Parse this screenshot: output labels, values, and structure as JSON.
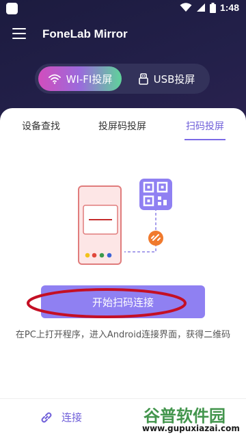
{
  "status_bar": {
    "time": "1:48"
  },
  "app_bar": {
    "title": "FoneLab Mirror",
    "menu_icon": "hamburger-icon"
  },
  "mode_switch": {
    "options": [
      {
        "label": "WI-FI投屏",
        "icon": "wifi-icon",
        "selected": true
      },
      {
        "label": "USB投屏",
        "icon": "usb-icon",
        "selected": false
      }
    ]
  },
  "tabs": [
    {
      "label": "设备查找",
      "active": false
    },
    {
      "label": "投屏码投屏",
      "active": false
    },
    {
      "label": "扫码投屏",
      "active": true
    }
  ],
  "main": {
    "start_button": "开始扫码连接",
    "hint": "在PC上打开程序，进入Android连接界面，获得二维码"
  },
  "bottom": {
    "connect_label": "连接",
    "connect_icon": "link-icon"
  },
  "watermark": {
    "text": "谷普软件园",
    "url": "www.gupuxiazai.com"
  },
  "colors": {
    "accent": "#7b6ae6",
    "button": "#8f80f2",
    "header_bg": "#1b1a3d",
    "annotation": "#c40f24"
  }
}
